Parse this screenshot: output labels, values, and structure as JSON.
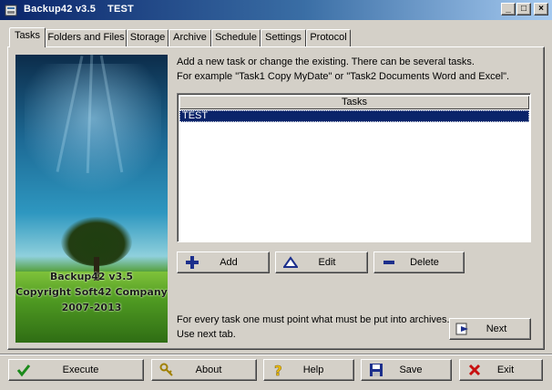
{
  "window": {
    "title": "Backup42 v3.5    TEST",
    "minimize_glyph": "_",
    "maximize_glyph": "□",
    "close_glyph": "×"
  },
  "tabs": [
    {
      "label": "Tasks",
      "active": true
    },
    {
      "label": "Folders and Files",
      "active": false
    },
    {
      "label": "Storage",
      "active": false
    },
    {
      "label": "Archive",
      "active": false
    },
    {
      "label": "Schedule",
      "active": false
    },
    {
      "label": "Settings",
      "active": false
    },
    {
      "label": "Protocol",
      "active": false
    }
  ],
  "splash": {
    "line1": "Backup42 v3.5",
    "line2": "Copyright Soft42 Company",
    "line3": "2007-2013"
  },
  "tasks_panel": {
    "instruction_line1": "Add a new task or change the existing. There can be several tasks.",
    "instruction_line2": "For example \"Task1 Copy MyDate\" or \"Task2 Documents Word and Excel\".",
    "list_header": "Tasks",
    "items": [
      {
        "name": "TEST",
        "selected": true
      }
    ],
    "add_label": "Add",
    "edit_label": "Edit",
    "delete_label": "Delete",
    "footer_line1": "For every task one must point what must be put into archives.",
    "footer_line2": "Use next tab.",
    "next_label": "Next"
  },
  "bottom_bar": {
    "execute_label": "Execute",
    "about_label": "About",
    "help_label": "Help",
    "save_label": "Save",
    "exit_label": "Exit"
  },
  "colors": {
    "titlebar_start": "#0a246a",
    "titlebar_end": "#a6caf0",
    "selection": "#0a246a",
    "face": "#d4d0c8",
    "icon_blue": "#1c2f8c",
    "icon_green": "#1a8a1a",
    "icon_red": "#c81010",
    "icon_yellow": "#f0c000"
  },
  "icons": {
    "app": "app-icon",
    "add": "plus-icon",
    "edit": "triangle-icon",
    "delete": "minus-icon",
    "next": "next-arrow-icon",
    "execute": "checkmark-icon",
    "about": "key-icon",
    "help": "question-icon",
    "save": "floppy-icon",
    "exit": "x-icon"
  }
}
